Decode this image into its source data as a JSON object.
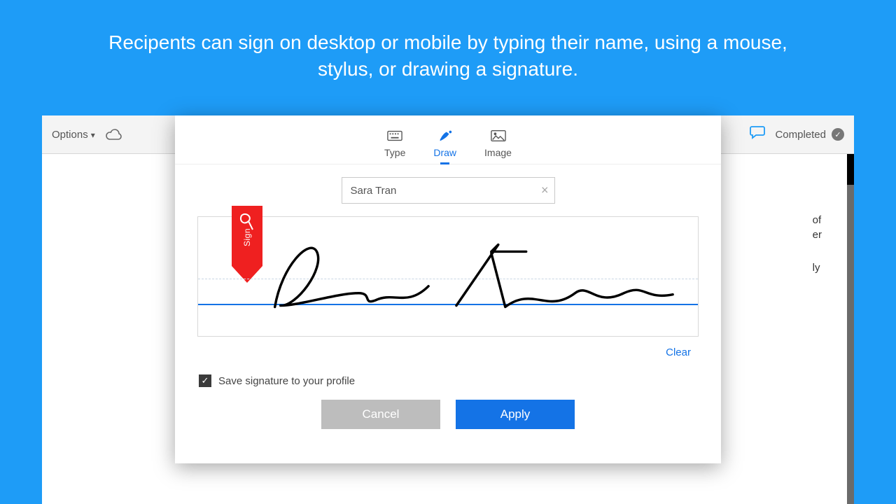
{
  "caption": "Recipents can sign on desktop or mobile by typing their name, using a mouse, stylus, or drawing a signature.",
  "toolbar": {
    "options": "Options",
    "completed": "Completed"
  },
  "bg_snippets": {
    "a": "of",
    "b": "er",
    "c": "ly"
  },
  "tabs": {
    "type": "Type",
    "draw": "Draw",
    "image": "Image"
  },
  "name_value": "Sara Tran",
  "flag_label": "Sign",
  "clear": "Clear",
  "save_label": "Save signature to your profile",
  "cancel": "Cancel",
  "apply": "Apply"
}
